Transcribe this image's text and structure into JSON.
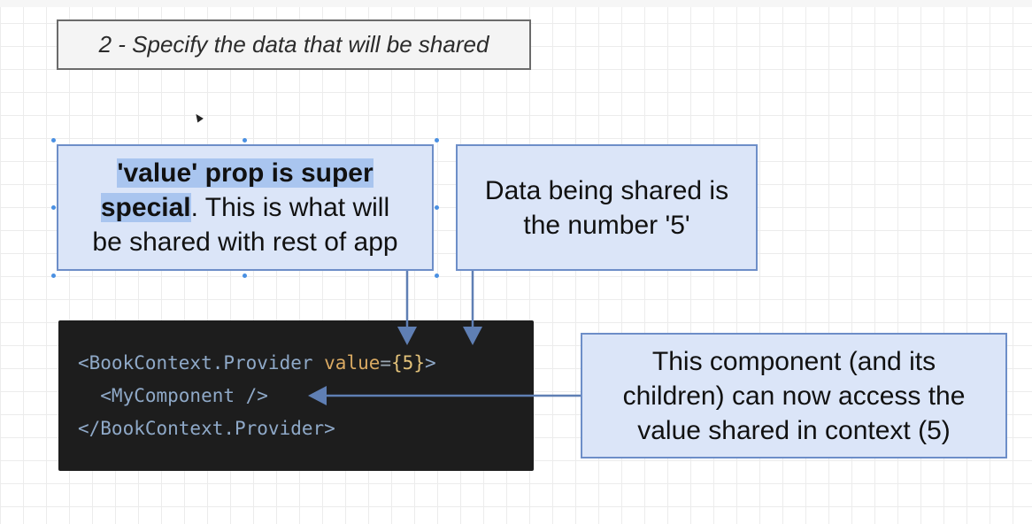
{
  "title": "2 - Specify the data that will be shared",
  "note_value_prop": {
    "strong_1": "'value' prop is super",
    "strong_2": "special",
    "text_2": ". This is what will",
    "text_3": "be shared with rest of app"
  },
  "note_data": {
    "line_1": "Data being shared is",
    "line_2": "the number '5'"
  },
  "note_component": {
    "line_1": "This component (and its",
    "line_2": "children) can now access the",
    "line_3": "value shared in context (5)"
  },
  "code": {
    "line_1_tag": "<BookContext.Provider ",
    "line_1_attr": "value",
    "line_1_eq": "=",
    "line_1_val": "{5}",
    "line_1_close": ">",
    "line_2": "  <MyComponent />",
    "line_3": "</BookContext.Provider>"
  },
  "colors": {
    "note_fill": "#dbe5f8",
    "note_border": "#6d8ec8",
    "highlight": "#a9c5ef",
    "arrow": "#5f7fb4",
    "code_background": "#1d1d1d",
    "code_tag": "#8fa9c8",
    "code_attr": "#d9a962"
  }
}
